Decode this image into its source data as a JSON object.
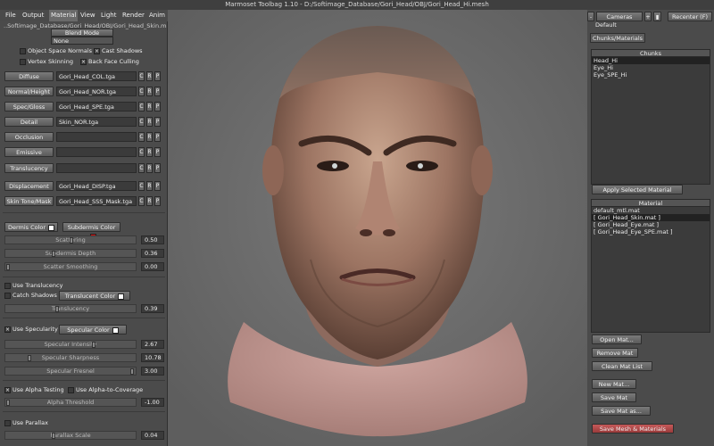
{
  "title": "Marmoset Toolbag 1.10 - D:/Softimage_Database/Gori_Head/OBJ/Gori_Head_Hi.mesh",
  "menu": [
    "File",
    "Output",
    "Material",
    "View",
    "Light",
    "Render",
    "Anim"
  ],
  "path_line": "..Softimage_Database/Gori_Head/OBJ/Gori_Head_Skin.mat",
  "blend_mode": {
    "label": "Blend Mode",
    "value": "None"
  },
  "options": {
    "object_space_normals": "Object Space Normals",
    "cast_shadows": "Cast Shadows",
    "vertex_skinning": "Vertex Skinning",
    "back_face_culling": "Back Face Culling"
  },
  "maps": [
    {
      "label": "Diffuse",
      "value": "Gori_Head_COL.tga"
    },
    {
      "label": "Normal/Height",
      "value": "Gori_Head_NOR.tga"
    },
    {
      "label": "Spec/Gloss",
      "value": "Gori_Head_SPE.tga"
    },
    {
      "label": "Detail",
      "value": "Skin_NOR.tga"
    },
    {
      "label": "Occlusion",
      "value": ""
    },
    {
      "label": "Emissive",
      "value": ""
    },
    {
      "label": "Translucency",
      "value": ""
    },
    {
      "label": "Displacement",
      "value": "Gori_Head_DISP.tga"
    },
    {
      "label": "Skin Tone/Mask",
      "value": "Gori_Head_SSS_Mask.tga"
    }
  ],
  "crp": [
    "C",
    "R",
    "P"
  ],
  "skin": {
    "dermis_color": "Dermis Color",
    "subdermis_color": "Subdermis Color",
    "sliders": [
      {
        "label": "Scattering",
        "value": "0.50"
      },
      {
        "label": "Subdermis Depth",
        "value": "0.36"
      },
      {
        "label": "Scatter Smoothing",
        "value": "0.00"
      }
    ]
  },
  "translucency": {
    "use_translucency": "Use Translucency",
    "catch_shadows": "Catch Shadows",
    "translucent_color": "Translucent Color",
    "slider_label": "Translucency",
    "slider_value": "0.39"
  },
  "specularity": {
    "use_specularity": "Use Specularity",
    "specular_color": "Specular Color",
    "sliders": [
      {
        "label": "Specular Intensity",
        "value": "2.67"
      },
      {
        "label": "Specular Sharpness",
        "value": "10.78"
      },
      {
        "label": "Specular Fresnel",
        "value": "3.00"
      }
    ]
  },
  "alpha": {
    "use_alpha_testing": "Use Alpha Testing",
    "use_alpha_to_coverage": "Use Alpha-to-Coverage",
    "slider_label": "Alpha Threshold",
    "slider_value": "-1.00"
  },
  "parallax": {
    "use_parallax": "Use Parallax",
    "slider_label": "Parallax Scale",
    "slider_value": "0.04"
  },
  "right": {
    "minus": "-",
    "cameras": "Cameras",
    "plus": "+",
    "recenter": "Recenter (F)",
    "camera_default": "Default",
    "tab": "Chunks/Materials",
    "chunks_header": "Chunks",
    "chunks": [
      "Head_Hi",
      "Eye_Hi",
      "Eye_SPE_Hi"
    ],
    "apply_selected_material": "Apply Selected Material",
    "material_header": "Material",
    "materials": [
      "default_mtl.mat",
      "[ Gori_Head_Skin.mat ]",
      "[ Gori_Head_Eye.mat ]",
      "[ Gori_Head_Eye_SPE.mat ]"
    ],
    "open_mat": "Open Mat...",
    "remove_mat": "Remove Mat",
    "clean_mat_list": "Clean Mat List",
    "new_mat": "New Mat...",
    "save_mat": "Save Mat",
    "save_mat_as": "Save Mat as...",
    "save_mesh_materials": "Save Mesh & Materials"
  },
  "colors": {
    "subdermis": "#e01010",
    "white": "#ffffff",
    "save_mesh_button": "#b84a4a"
  }
}
